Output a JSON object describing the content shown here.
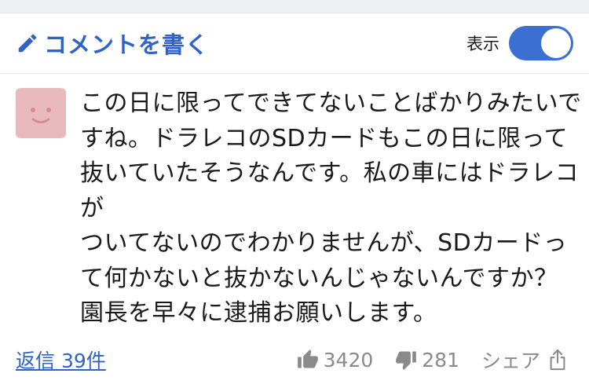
{
  "header": {
    "write_label": "コメントを書く",
    "display_label": "表示",
    "display_toggle_on": true,
    "accent_color": "#3b6fd1"
  },
  "comment": {
    "avatar_color": "#e8b9bd",
    "lines": [
      "この日に限ってできてないことばかりみたいで",
      "すね。ドラレコのSDカードもこの日に限って",
      "抜いていたそうなんです。私の車にはドラレコ",
      "が",
      "ついてないのでわかりませんが、SDカードっ",
      "て何かないと抜かないんじゃないんですか？",
      "園長を早々に逮捕お願いします。"
    ]
  },
  "footer": {
    "reply_label": "返信 39件",
    "like_count": "3420",
    "dislike_count": "281",
    "share_label": "シェア"
  }
}
